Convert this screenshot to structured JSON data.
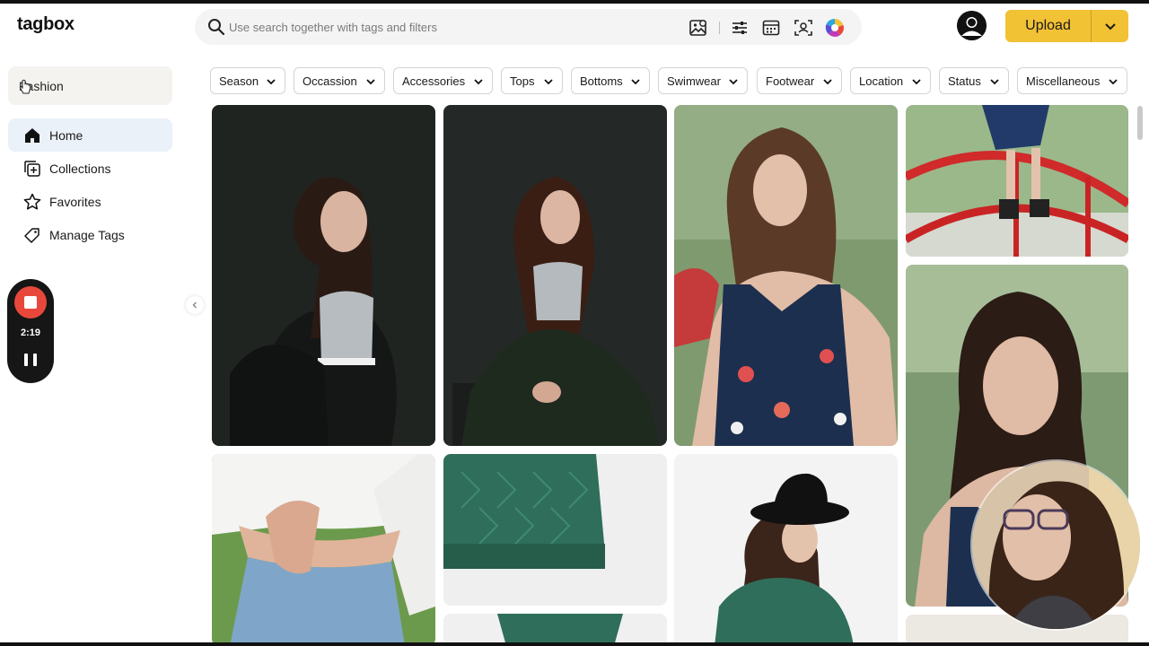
{
  "app": {
    "logo": "tagbox"
  },
  "search": {
    "placeholder": "Use search together with tags and filters"
  },
  "toolbar_icons": [
    "image-search-icon",
    "sliders-icon",
    "calendar-icon",
    "face-scan-icon",
    "color-wheel-icon"
  ],
  "header": {
    "upload_label": "Upload"
  },
  "sidebar": {
    "workspace": "Fashion",
    "items": [
      {
        "label": "Home",
        "icon": "home-icon",
        "active": true
      },
      {
        "label": "Collections",
        "icon": "collections-icon",
        "active": false
      },
      {
        "label": "Favorites",
        "icon": "star-icon",
        "active": false
      },
      {
        "label": "Manage Tags",
        "icon": "tag-icon",
        "active": false
      }
    ]
  },
  "recorder": {
    "time": "2:19"
  },
  "filters": [
    "Season",
    "Occassion",
    "Accessories",
    "Tops",
    "Bottoms",
    "Swimwear",
    "Footwear",
    "Location",
    "Status",
    "Miscellaneous"
  ],
  "colors": {
    "accent_upload": "#f2c235",
    "active_nav": "#eaf1f8",
    "record_red": "#e8483b"
  }
}
